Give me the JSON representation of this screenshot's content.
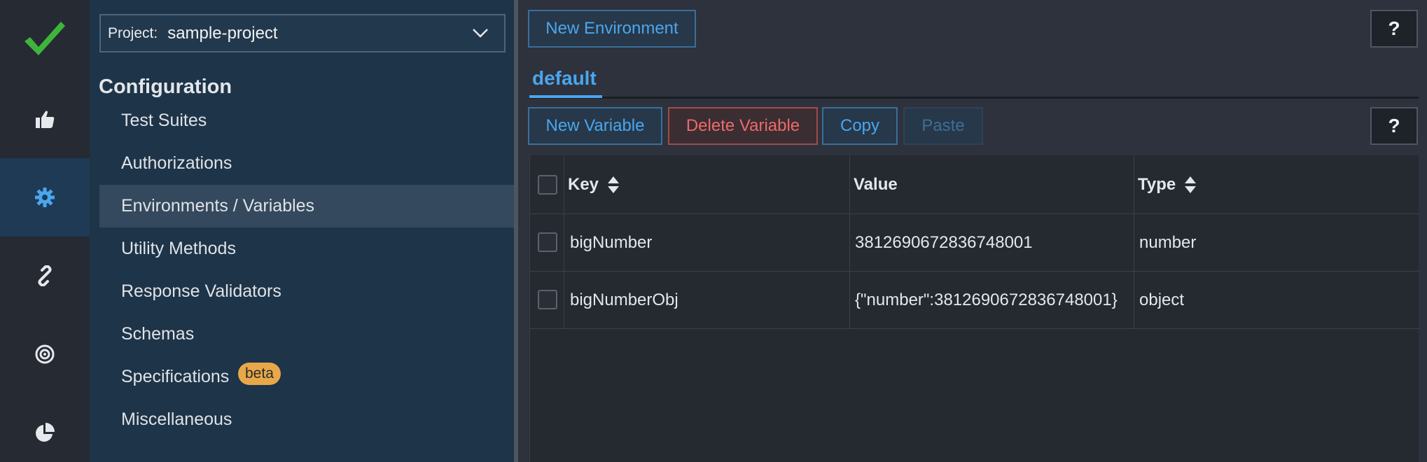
{
  "project": {
    "label": "Project:",
    "value": "sample-project"
  },
  "config": {
    "title": "Configuration",
    "items": [
      {
        "label": "Test Suites"
      },
      {
        "label": "Authorizations"
      },
      {
        "label": "Environments / Variables",
        "active": true
      },
      {
        "label": "Utility Methods"
      },
      {
        "label": "Response Validators"
      },
      {
        "label": "Schemas"
      },
      {
        "label": "Specifications",
        "badge": "beta"
      },
      {
        "label": "Miscellaneous"
      }
    ]
  },
  "rail_icons": [
    "checkmark-logo-icon",
    "thumbs-up-icon",
    "gear-icon",
    "link-icon",
    "target-icon",
    "pie-chart-icon"
  ],
  "toolbar": {
    "new_environment": "New Environment",
    "help": "?",
    "new_variable": "New Variable",
    "delete_variable": "Delete Variable",
    "copy": "Copy",
    "paste": "Paste"
  },
  "environment_tab": {
    "label": "default"
  },
  "table": {
    "columns": {
      "key": "Key",
      "value": "Value",
      "type": "Type"
    },
    "rows": [
      {
        "key": "bigNumber",
        "value": "3812690672836748001",
        "type": "number"
      },
      {
        "key": "bigNumberObj",
        "value": "{\"number\":3812690672836748001}",
        "type": "object"
      }
    ]
  },
  "colors": {
    "accent": "#4aa6ee",
    "danger": "#ee6a66",
    "badge": "#e8a84a",
    "logo": "#3db53b"
  }
}
